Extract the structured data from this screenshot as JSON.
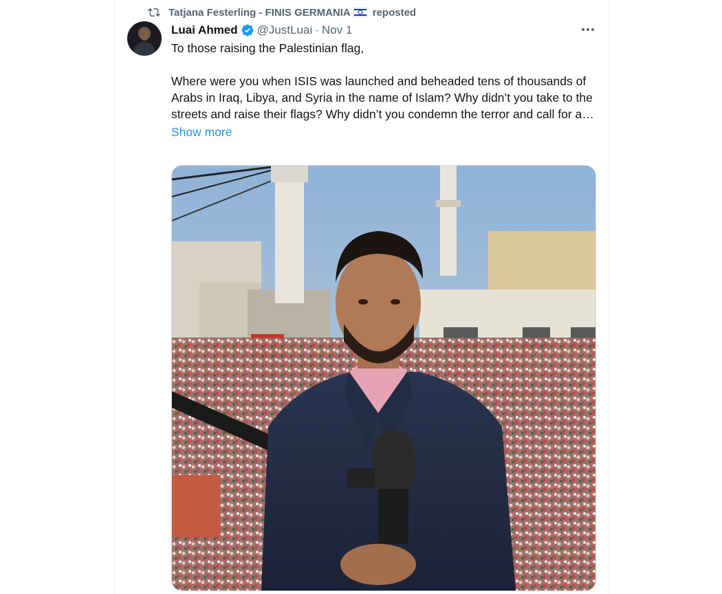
{
  "repost": {
    "user": "Tatjana Festerling - FINIS GERMANIA",
    "suffix": "reposted"
  },
  "author": {
    "name": "Luai Ahmed",
    "handle": "@JustLuai",
    "date": "Nov 1"
  },
  "tweet": {
    "line1": "To those raising the Palestinian flag,",
    "line2": "Where were you when ISIS was launched and beheaded tens of thousands of Arabs in Iraq, Libya, and Syria in the name of Islam? Why didn’t you take to the streets and raise their flags? Why didn’t you condemn the terror and call for a…",
    "show_more": "Show more"
  },
  "colors": {
    "accent": "#1d9bf0",
    "secondary_text": "#536471",
    "primary_text": "#0f1419"
  },
  "icons": {
    "repost": "repost-icon",
    "verified": "verified-badge-icon",
    "more": "more-options-icon"
  }
}
